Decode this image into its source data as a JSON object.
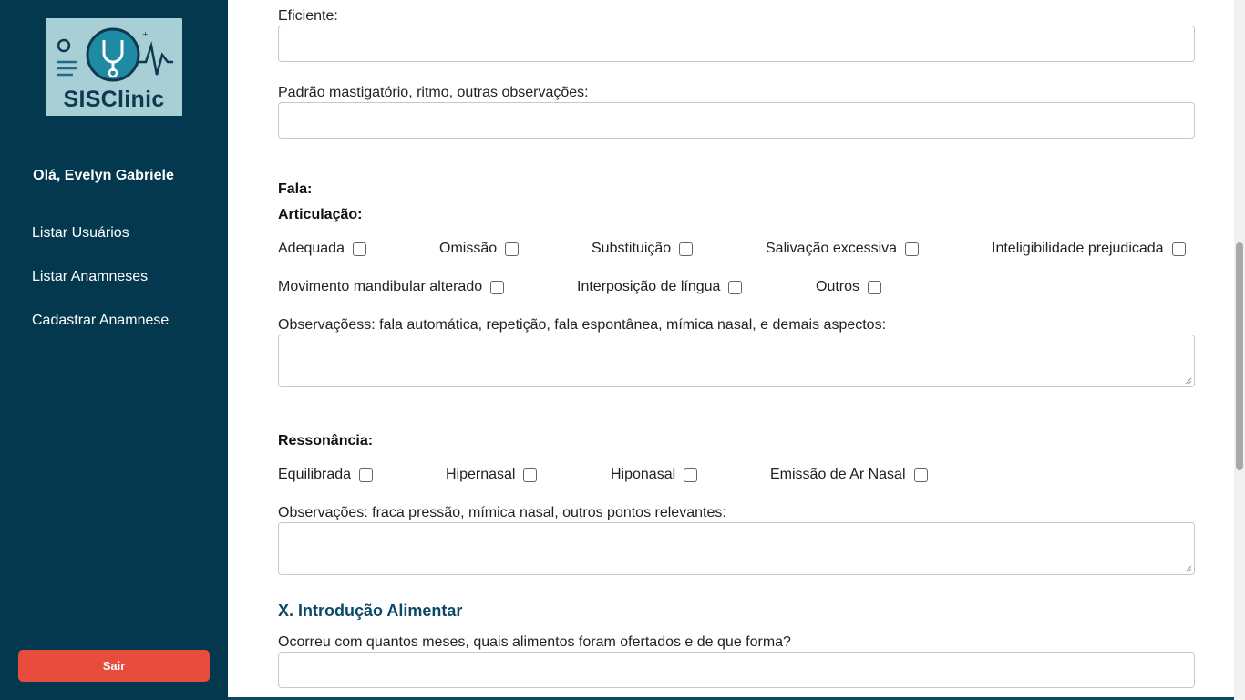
{
  "sidebar": {
    "logo_text": "SISClinic",
    "greeting": "Olá, Evelyn Gabriele",
    "nav": [
      "Listar Usuários",
      "Listar Anamneses",
      "Cadastrar Anamnese"
    ],
    "logout_label": "Sair"
  },
  "form": {
    "eficiente_label": "Eficiente:",
    "padrao_label": "Padrão mastigatório, ritmo, outras observações:",
    "fala_heading": "Fala:",
    "articulacao_heading": "Articulação:",
    "articulacao_options": [
      {
        "label": "Adequada",
        "checked": false
      },
      {
        "label": "Omissão",
        "checked": false
      },
      {
        "label": "Substituição",
        "checked": false
      },
      {
        "label": "Salivação excessiva",
        "checked": false
      },
      {
        "label": "Inteligibilidade prejudicada",
        "checked": false
      },
      {
        "label": "Movimento mandibular alterado",
        "checked": false
      },
      {
        "label": "Interposição de língua",
        "checked": false
      },
      {
        "label": "Outros",
        "checked": false
      }
    ],
    "obs_fala_label": "Observaçõess: fala automática, repetição, fala espontânea, mímica nasal, e demais aspectos:",
    "ressonancia_heading": "Ressonância:",
    "ressonancia_options": [
      {
        "label": "Equilibrada",
        "checked": false
      },
      {
        "label": "Hipernasal",
        "checked": false
      },
      {
        "label": "Hiponasal",
        "checked": false
      },
      {
        "label": "Emissão de Ar Nasal",
        "checked": false
      }
    ],
    "obs_ressonancia_label": "Observações: fraca pressão, mímica nasal, outros pontos relevantes:",
    "section_title": "X. Introdução Alimentar",
    "introducao_label": "Ocorreu com quantos meses, quais alimentos foram ofertados e de que forma?"
  },
  "colors": {
    "sidebar_bg": "#04384f",
    "logout_bg": "#e74c3c",
    "section_title": "#0b4a66"
  }
}
